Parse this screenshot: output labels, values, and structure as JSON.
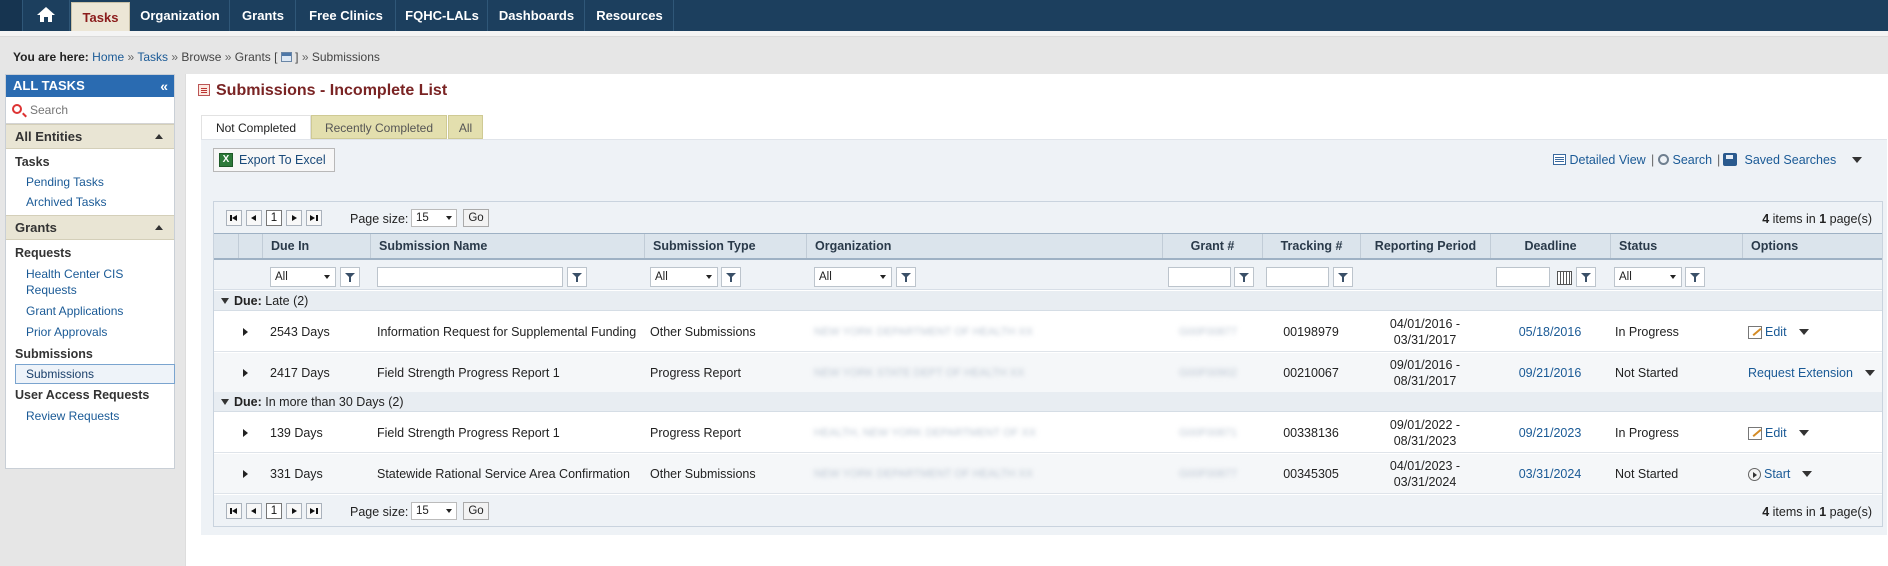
{
  "nav": {
    "home_icon": "home-icon",
    "items": [
      {
        "label": "Tasks",
        "active": true
      },
      {
        "label": "Organization"
      },
      {
        "label": "Grants"
      },
      {
        "label": "Free Clinics"
      },
      {
        "label": "FQHC-LALs"
      },
      {
        "label": "Dashboards"
      },
      {
        "label": "Resources"
      }
    ]
  },
  "breadcrumb": {
    "prefix": "You are here:",
    "home": "Home",
    "tasks": "Tasks",
    "browse": "Browse",
    "grants": "Grants [",
    "grants_close": "]",
    "current": "Submissions",
    "sep": "»"
  },
  "sidebar": {
    "title": "ALL TASKS",
    "collapse_icon": "«",
    "search_placeholder": "Search",
    "groups": {
      "all_entities": "All Entities",
      "grants": "Grants"
    },
    "tasks_section": "Tasks",
    "pending": "Pending Tasks",
    "archived": "Archived Tasks",
    "requests_section": "Requests",
    "hc_cis": "Health Center CIS",
    "hc_cis_2": "Requests",
    "grant_apps": "Grant Applications",
    "prior_approvals": "Prior Approvals",
    "submissions_section": "Submissions",
    "submissions_link": "Submissions",
    "user_access_section": "User Access Requests",
    "review_requests": "Review Requests"
  },
  "main": {
    "title": "Submissions - Incomplete List",
    "tabs": {
      "not_completed": "Not Completed",
      "recently_completed": "Recently Completed",
      "all": "All"
    },
    "export_label": "Export To Excel",
    "detailed_view": "Detailed View",
    "search": "Search",
    "saved_searches": "Saved Searches",
    "pipe": "|"
  },
  "pager": {
    "page": "1",
    "page_size_label": "Page size:",
    "page_size": "15",
    "go": "Go",
    "items_count": "4",
    "items_text": " items in ",
    "pages_count": "1",
    "pages_text": " page(s)"
  },
  "columns": {
    "due_in": "Due In",
    "name": "Submission Name",
    "type": "Submission Type",
    "org": "Organization",
    "grant": "Grant #",
    "tracking": "Tracking #",
    "period": "Reporting Period",
    "deadline": "Deadline",
    "status": "Status",
    "options": "Options"
  },
  "filters": {
    "all": "All"
  },
  "groups": {
    "late_label": "Due:",
    "late_value": "Late (2)",
    "future_label": "Due:",
    "future_value": "In more than 30 Days (2)"
  },
  "rows": [
    {
      "due": "2543 Days",
      "name": "Information Request for Supplemental Funding",
      "type": "Other Submissions",
      "org": "NEW YORK DEPARTMENT OF HEALTH XX",
      "grant": "G00F00877",
      "tracking": "00198979",
      "period_start": "04/01/2016 -",
      "period_end": "03/31/2017",
      "deadline": "05/18/2016",
      "status": "In Progress",
      "option": "Edit",
      "option_icon": "edit-icon"
    },
    {
      "due": "2417 Days",
      "name": "Field Strength Progress Report 1",
      "type": "Progress Report",
      "org": "NEW YORK STATE DEPT OF HEALTH XX",
      "grant": "G00F00902",
      "tracking": "00210067",
      "period_start": "09/01/2016 -",
      "period_end": "08/31/2017",
      "deadline": "09/21/2016",
      "status": "Not Started",
      "option": "Request Extension",
      "option_icon": ""
    },
    {
      "due": "139 Days",
      "name": "Field Strength Progress Report 1",
      "type": "Progress Report",
      "org": "HEALTH, NEW YORK DEPARTMENT OF XX",
      "grant": "G00F00871",
      "tracking": "00338136",
      "period_start": "09/01/2022 -",
      "period_end": "08/31/2023",
      "deadline": "09/21/2023",
      "status": "In Progress",
      "option": "Edit",
      "option_icon": "edit-icon"
    },
    {
      "due": "331 Days",
      "name": "Statewide Rational Service Area Confirmation",
      "type": "Other Submissions",
      "org": "NEW YORK DEPARTMENT OF HEALTH XX",
      "grant": "G00F00877",
      "tracking": "00345305",
      "period_start": "04/01/2023 -",
      "period_end": "03/31/2024",
      "deadline": "03/31/2024",
      "status": "Not Started",
      "option": "Start",
      "option_icon": "start-icon"
    }
  ]
}
